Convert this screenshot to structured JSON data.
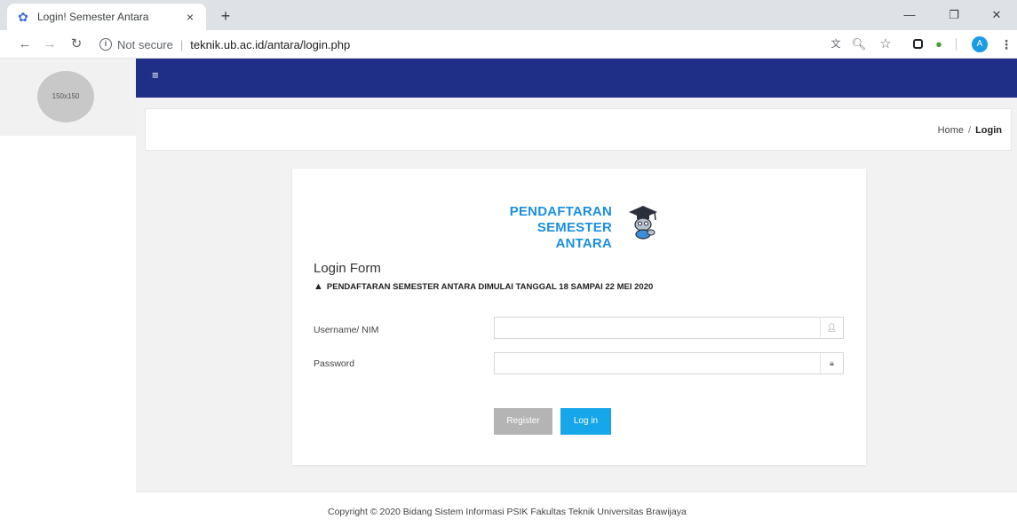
{
  "browser": {
    "tab_title": "Login! Semester Antara",
    "tab_close": "×",
    "new_tab": "+",
    "not_secure": "Not secure",
    "url": "teknik.ub.ac.id/antara/login.php",
    "profile_initial": "A"
  },
  "sidebar": {
    "avatar_placeholder": "150x150"
  },
  "header": {
    "menu_icon": "hamburger-menu-icon"
  },
  "breadcrumb": {
    "home": "Home",
    "separator": "/",
    "current": "Login"
  },
  "login": {
    "logo_line1": "PENDAFTARAN",
    "logo_line2": "SEMESTER ANTARA",
    "title": "Login Form",
    "notice": "PENDAFTARAN SEMESTER ANTARA DIMULAI TANGGAL 18 SAMPAI 22 MEI 2020",
    "username_label": "Username/ NIM",
    "username_value": "",
    "password_label": "Password",
    "password_value": "",
    "register_label": "Register",
    "login_label": "Log in"
  },
  "footer": {
    "copyright": "Copyright © 2020 Bidang Sistem Informasi PSIK Fakultas Teknik Universitas Brawijaya"
  },
  "colors": {
    "header_bg": "#1f2f88",
    "logo_blue": "#1b8fe0",
    "login_button": "#16a7ea",
    "register_button": "#b4b4b4"
  }
}
